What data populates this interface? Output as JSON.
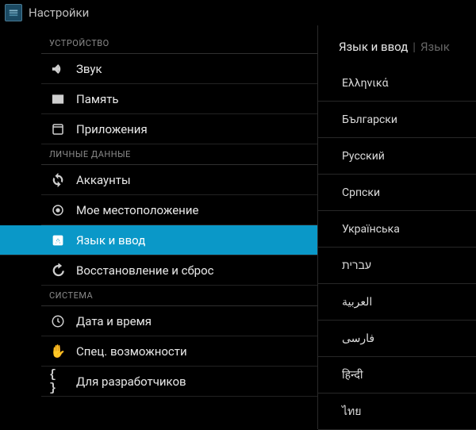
{
  "app_title": "Настройки",
  "left": {
    "sections": {
      "device": "УСТРОЙСТВО",
      "personal": "ЛИЧНЫЕ ДАННЫЕ",
      "system": "СИСТЕМА"
    },
    "items": {
      "sound": "Звук",
      "storage": "Память",
      "apps": "Приложения",
      "accounts": "Аккаунты",
      "location": "Мое местоположение",
      "language": "Язык и ввод",
      "backup": "Восстановление и сброс",
      "datetime": "Дата и время",
      "accessibility": "Спец. возможности",
      "developer": "Для разработчиков"
    }
  },
  "right": {
    "breadcrumb1": "Язык и ввод",
    "breadcrumb2": "Язык",
    "languages": [
      "Ελληνικά",
      "Български",
      "Русский",
      "Српски",
      "Українська",
      "עברית",
      "العربية",
      "فارسی",
      "हिन्दी",
      "ไทย"
    ]
  }
}
